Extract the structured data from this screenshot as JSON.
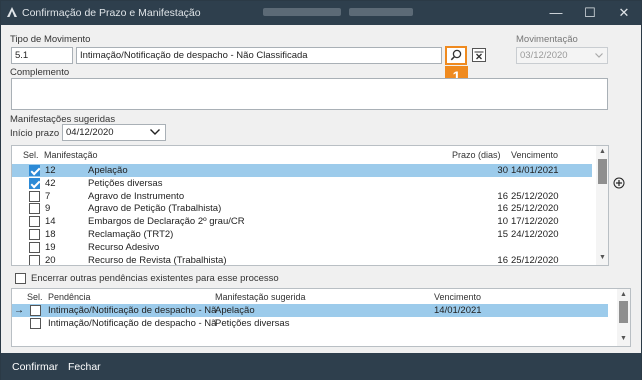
{
  "window": {
    "title": "Confirmação de Prazo e Manifestação",
    "minimize_glyph": "—",
    "maximize_glyph": "☐",
    "close_glyph": "✕"
  },
  "form": {
    "tipo_label": "Tipo de Movimento",
    "tipo_code": "5.1",
    "tipo_desc": "Intimação/Notificação de despacho - Não Classificada",
    "movimentacao_label": "Movimentação",
    "movimentacao_date": "03/12/2020",
    "complemento_label": "Complemento",
    "complemento_value": "",
    "manifestacoes_label": "Manifestações sugeridas",
    "inicio_label": "Início prazo",
    "inicio_date": "04/12/2020",
    "badge": "1"
  },
  "manifest_grid": {
    "headers": {
      "sel": "Sel.",
      "manifestacao": "Manifestação",
      "prazo": "Prazo (dias)",
      "vencimento": "Vencimento"
    },
    "rows": [
      {
        "checked": true,
        "code": "12",
        "name": "Apelação",
        "prazo": "30",
        "venc": "14/01/2021",
        "selected": true,
        "current": true
      },
      {
        "checked": true,
        "code": "42",
        "name": "Petições diversas",
        "prazo": "",
        "venc": "",
        "selected": false,
        "current": false
      },
      {
        "checked": false,
        "code": "7",
        "name": "Agravo de Instrumento",
        "prazo": "16",
        "venc": "25/12/2020",
        "selected": false,
        "current": false
      },
      {
        "checked": false,
        "code": "9",
        "name": "Agravo de Petição (Trabalhista)",
        "prazo": "16",
        "venc": "25/12/2020",
        "selected": false,
        "current": false
      },
      {
        "checked": false,
        "code": "14",
        "name": "Embargos de Declaração 2º grau/CR",
        "prazo": "10",
        "venc": "17/12/2020",
        "selected": false,
        "current": false
      },
      {
        "checked": false,
        "code": "18",
        "name": "Reclamação (TRT2)",
        "prazo": "15",
        "venc": "24/12/2020",
        "selected": false,
        "current": false
      },
      {
        "checked": false,
        "code": "19",
        "name": "Recurso Adesivo",
        "prazo": "",
        "venc": "",
        "selected": false,
        "current": false
      },
      {
        "checked": false,
        "code": "20",
        "name": "Recurso de Revista (Trabalhista)",
        "prazo": "16",
        "venc": "25/12/2020",
        "selected": false,
        "current": false
      }
    ]
  },
  "encerrar_label": "Encerrar outras pendências existentes para esse processo",
  "pend_grid": {
    "headers": {
      "sel": "Sel.",
      "pendencia": "Pendência",
      "manifestacao": "Manifestação sugerida",
      "vencimento": "Vencimento"
    },
    "rows": [
      {
        "checked": false,
        "pendencia": "Intimação/Notificação de despacho - Nã",
        "manifestacao": "Apelação",
        "venc": "14/01/2021",
        "selected": true,
        "current": true
      },
      {
        "checked": false,
        "pendencia": "Intimação/Notificação de despacho - Nã",
        "manifestacao": "Petições diversas",
        "venc": "",
        "selected": false,
        "current": false
      }
    ]
  },
  "footer": {
    "confirmar": "Confirmar",
    "fechar": "Fechar"
  },
  "icons": {
    "app": "app-triangle-icon",
    "search": "magnifier-icon",
    "clear": "clear-field-icon",
    "add": "add-circle-icon",
    "dropdown": "chevron-down-icon"
  },
  "colors": {
    "titlebar": "#2e3f4d",
    "selection": "#9ccbeb",
    "checkbox": "#2c8ad6",
    "highlight": "#ef8a1f"
  }
}
